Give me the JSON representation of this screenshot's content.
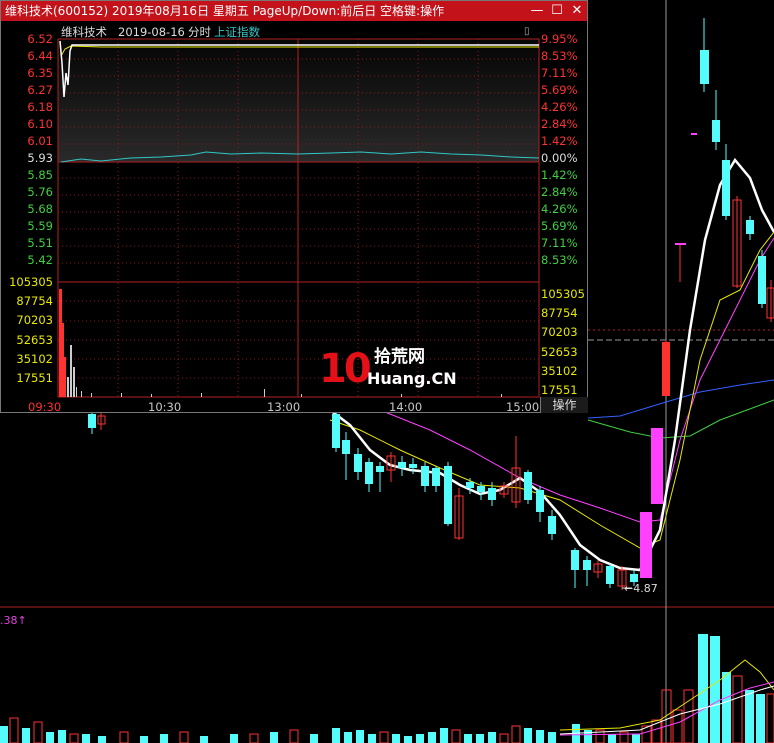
{
  "window": {
    "title": "维科技术(600152) 2019年08月16日 星期五 PageUp/Down:前后日 空格键:操作",
    "stock_name": "维科技术",
    "date": "2019-08-16",
    "mode": "分时",
    "index_link": "上证指数",
    "operate_button": "操作",
    "min_icon": "minimize-icon",
    "max_icon": "maximize-icon",
    "close_icon": "close-icon"
  },
  "price_ticks": [
    "6.52",
    "6.44",
    "6.35",
    "6.27",
    "6.18",
    "6.10",
    "6.01",
    "5.93",
    "5.85",
    "5.76",
    "5.68",
    "5.59",
    "5.51",
    "5.42"
  ],
  "pct_ticks": [
    "9.95%",
    "8.53%",
    "7.11%",
    "5.69%",
    "4.26%",
    "2.84%",
    "1.42%",
    "0.00%",
    "1.42%",
    "2.84%",
    "4.26%",
    "5.69%",
    "7.11%",
    "8.53%"
  ],
  "volume_ticks": [
    "105305",
    "87754",
    "70203",
    "52653",
    "35102",
    "17551"
  ],
  "time_ticks": [
    "09:30",
    "10:30",
    "13:00",
    "14:00",
    "15:00"
  ],
  "kline": {
    "low_label": "4.87"
  },
  "lower_panel": {
    "indicator_value": ".38"
  },
  "watermark": {
    "logo": "10",
    "cn": "拾荒网",
    "en": "Huang.CN"
  },
  "colors": {
    "up": "#ff3232",
    "down": "#54fcfc",
    "flat": "#c0c0c0",
    "title_bar": "#c3121a",
    "price_line": "#ffffff",
    "avg_line": "#ffff00",
    "index_line": "#30c8c8",
    "ma_magenta": "#ff40ff",
    "ma_green": "#40d040",
    "ma_blue": "#3060ff"
  }
}
